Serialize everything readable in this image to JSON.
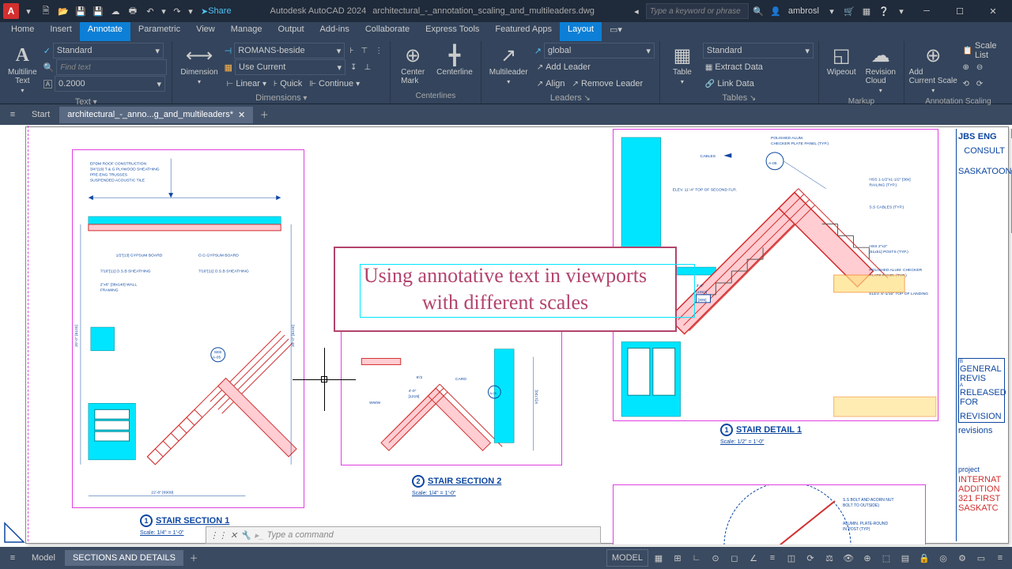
{
  "app": {
    "name": "Autodesk AutoCAD 2024",
    "file": "architectural_-_annotation_scaling_and_multileaders.dwg",
    "logo": "A"
  },
  "search": {
    "placeholder": "Type a keyword or phrase"
  },
  "user": {
    "name": "ambrosl"
  },
  "share": {
    "label": "Share"
  },
  "menu": {
    "items": [
      "Home",
      "Insert",
      "Annotate",
      "Parametric",
      "View",
      "Manage",
      "Output",
      "Add-ins",
      "Collaborate",
      "Express Tools",
      "Featured Apps",
      "Layout"
    ],
    "active": 2
  },
  "ribbon": {
    "text": {
      "label": "Text",
      "btn": "Multiline\nText",
      "style": "Standard",
      "find": "Find text",
      "height": "0.2000"
    },
    "dim": {
      "label": "Dimensions",
      "btn": "Dimension",
      "style": "ROMANS-beside",
      "linear": "Linear",
      "quick": "Quick",
      "continue": "Continue",
      "layer": "Use Current"
    },
    "center": {
      "label": "Centerlines",
      "mark": "Center\nMark",
      "line": "Centerline"
    },
    "leaders": {
      "label": "Leaders",
      "btn": "Multileader",
      "style": "global",
      "add": "Add Leader",
      "align": "Align",
      "remove": "Remove Leader"
    },
    "tables": {
      "label": "Tables",
      "btn": "Table",
      "style": "Standard",
      "extract": "Extract Data",
      "link": "Link Data"
    },
    "markup": {
      "label": "Markup",
      "wipeout": "Wipeout",
      "cloud": "Revision\nCloud"
    },
    "anno": {
      "label": "Annotation Scaling",
      "add": "Add\nCurrent Scale",
      "list": "Scale List"
    }
  },
  "tabs": {
    "start": "Start",
    "file": "architectural_-_anno...g_and_multileaders*"
  },
  "callout": {
    "text": "Using annotative text in viewports with different scales"
  },
  "views": {
    "v1": {
      "title": "STAIR SECTION 1",
      "num": "1",
      "scale": "Scale: 1/4\" = 1'-0\""
    },
    "v2": {
      "title": "STAIR SECTION 2",
      "num": "2",
      "scale": "Scale: 1/4\" = 1'-0\""
    },
    "v3": {
      "title": "STAIR DETAIL 1",
      "num": "1",
      "scale": "Scale: 1/2\" = 1'-0\""
    }
  },
  "titleblock": {
    "firm": "JBS",
    "eng": "ENG",
    "role": "CONSULT",
    "city": "SASKATOON",
    "revisions": "revisions",
    "rev1": "GENERAL REVIS",
    "rev2": "RELEASED FOR",
    "rev3": "REVISION",
    "project": "project",
    "pname1": "INTERNAT",
    "pname2": "ADDITION",
    "pname3": "321 FIRST",
    "pname4": "SASKATC"
  },
  "cmd": {
    "placeholder": "Type a command"
  },
  "status": {
    "model": "Model",
    "layout": "SECTIONS AND DETAILS",
    "space": "MODEL"
  }
}
